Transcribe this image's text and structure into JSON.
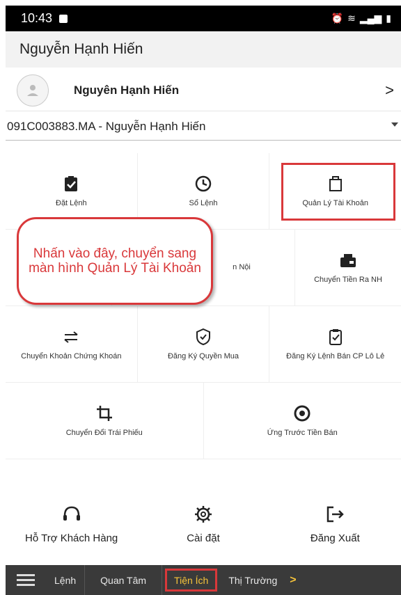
{
  "status": {
    "time": "10:43"
  },
  "header": {
    "title": "Nguyễn Hạnh Hiến"
  },
  "user": {
    "name": "Nguyên Hạnh Hiến",
    "chevron": ">"
  },
  "account": {
    "label": "091C003883.MA - Nguyễn Hạnh Hiến"
  },
  "grid": {
    "row1": [
      "Đặt Lệnh",
      "Sổ Lệnh",
      "Quản Lý Tài Khoản"
    ],
    "row2": [
      "",
      "n Nội",
      "Chuyển Tiền Ra NH"
    ],
    "row3": [
      "Chuyển Khoản Chứng Khoán",
      "Đăng Ký Quyền Mua",
      "Đăng Ký Lệnh Bán CP Lô Lẻ"
    ],
    "row4": [
      "Chuyển Đổi Trái Phiếu",
      "Ứng Trước Tiền Bán"
    ]
  },
  "callout": {
    "text": "Nhấn vào đây, chuyển sang màn hình Quản Lý Tài Khoản"
  },
  "actions": [
    "Hỗ Trợ Khách Hàng",
    "Cài đặt",
    "Đăng Xuất"
  ],
  "nav": {
    "items": [
      "Lệnh",
      "Quan Tâm",
      "Tiện Ích",
      "Thị Trường"
    ],
    "more": ">"
  },
  "colors": {
    "accent": "#d9383a",
    "nav_bg": "#3a3a3a",
    "active": "#f7c43a"
  }
}
